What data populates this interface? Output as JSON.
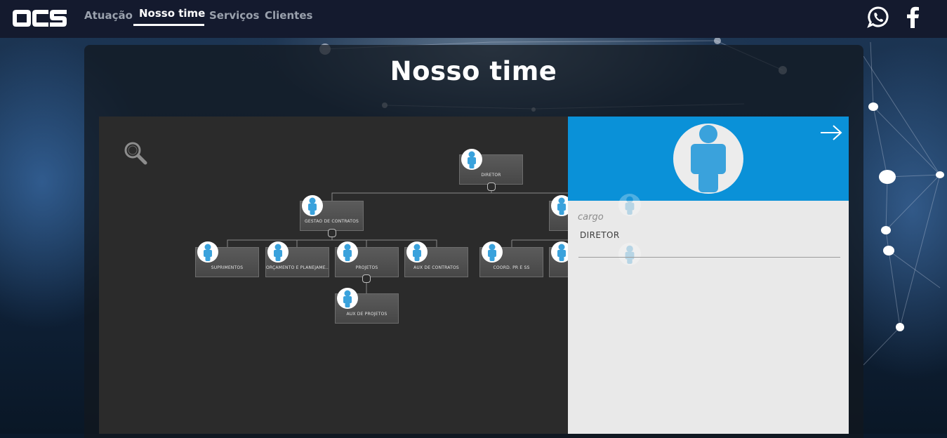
{
  "brand": {
    "logo_text": "OCS"
  },
  "nav": {
    "items": [
      {
        "label": "Atuação",
        "active": false
      },
      {
        "label": "Nosso time",
        "active": true
      },
      {
        "label": "Serviços",
        "active": false
      },
      {
        "label": "Clientes",
        "active": false
      }
    ]
  },
  "social": {
    "icons": [
      "whatsapp-icon",
      "facebook-icon"
    ]
  },
  "page": {
    "title": "Nosso time"
  },
  "orgchart": {
    "nodes": [
      {
        "id": "diretor",
        "label": "DIRETOR"
      },
      {
        "id": "gestao",
        "label": "GESTÃO DE CONTRATOS"
      },
      {
        "id": "suprimentos",
        "label": "SUPRIMENTOS"
      },
      {
        "id": "orcamento",
        "label": "ORÇAMENTO E PLANEJAME..."
      },
      {
        "id": "projetos",
        "label": "PROJETOS"
      },
      {
        "id": "aux-contratos",
        "label": "AUX DE CONTRATOS"
      },
      {
        "id": "coord",
        "label": "COORD. PR E SS"
      },
      {
        "id": "aux-projetos",
        "label": "AUX DE PROJETOS"
      }
    ]
  },
  "detail": {
    "field_label": "cargo",
    "field_value": "DIRETOR"
  },
  "colors": {
    "topbar": "#141a2e",
    "accent_blue": "#0a91d8",
    "avatar_blue": "#3aa2dc",
    "chart_bg": "#2b2b2b"
  }
}
